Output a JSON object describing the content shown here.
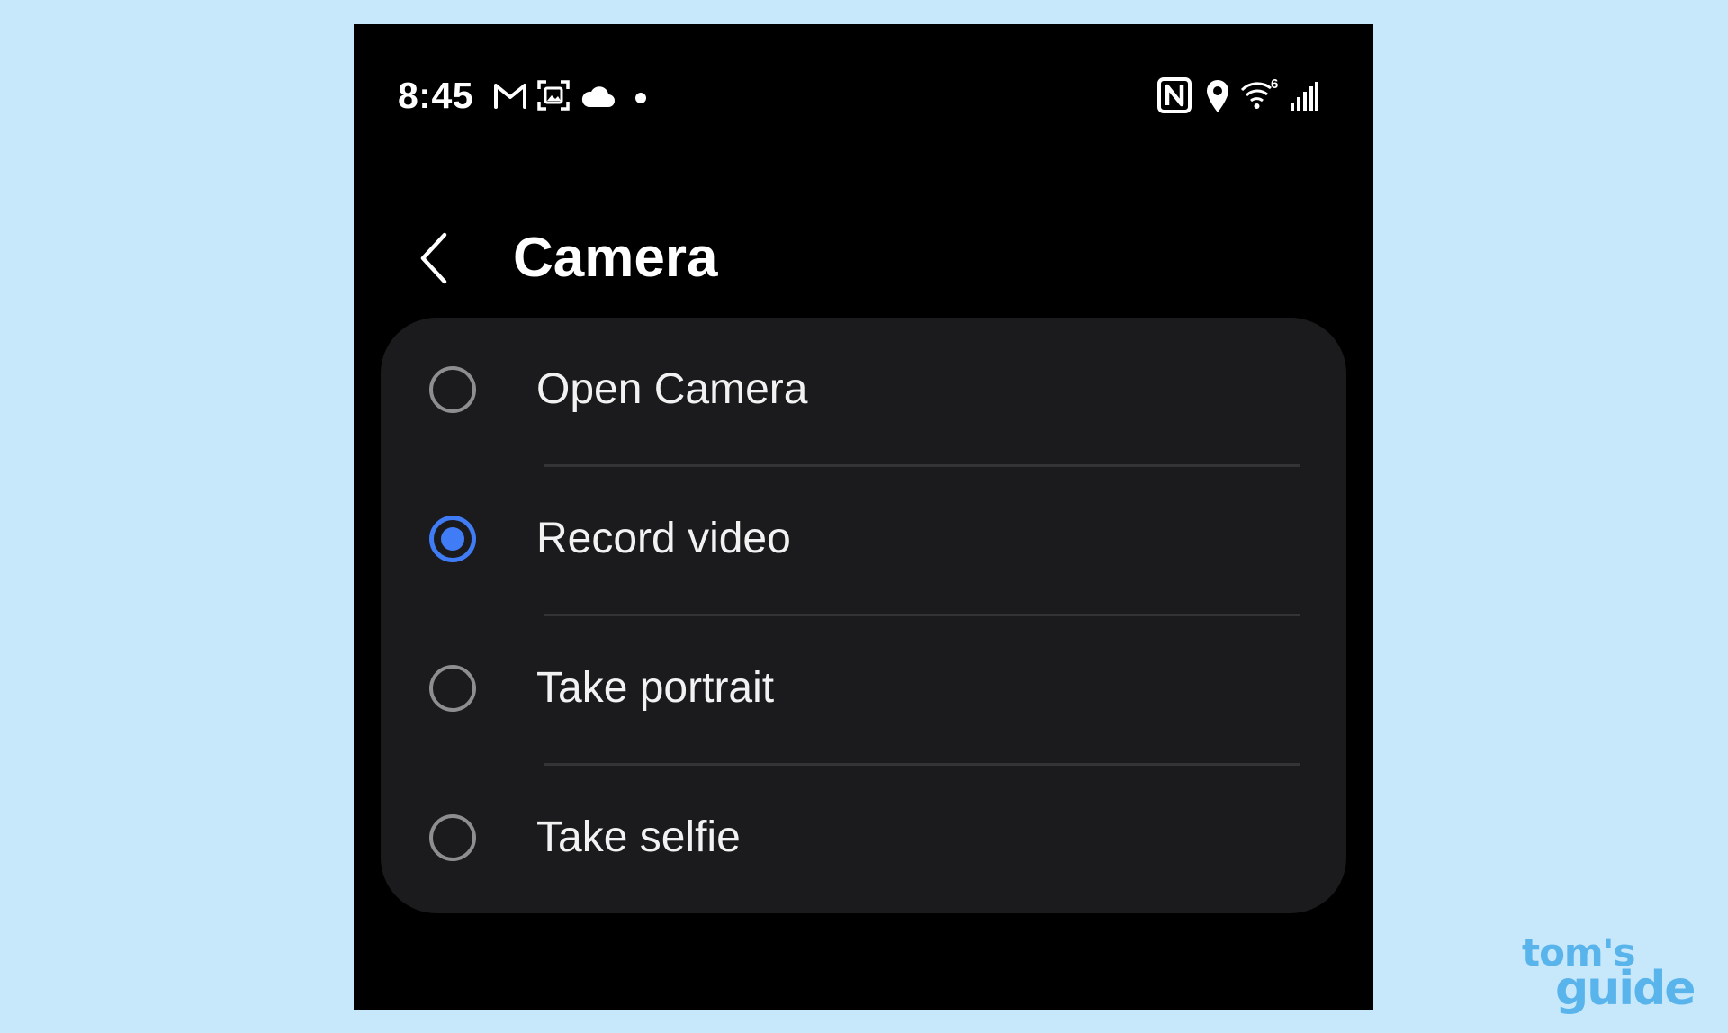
{
  "status_bar": {
    "time": "8:45",
    "left_icons": [
      "gmail-icon",
      "screenshot-icon",
      "cloud-icon",
      "notification-dot-icon"
    ],
    "right_icons": [
      "nfc-icon",
      "location-icon",
      "wifi-6-icon",
      "signal-icon"
    ],
    "wifi_badge": "6"
  },
  "header": {
    "back_icon": "chevron-left-icon",
    "title": "Camera"
  },
  "options": [
    {
      "label": "Open Camera",
      "selected": false
    },
    {
      "label": "Record video",
      "selected": true
    },
    {
      "label": "Take portrait",
      "selected": false
    },
    {
      "label": "Take selfie",
      "selected": false
    }
  ],
  "watermark": {
    "line1": "tom's",
    "line2": "guide"
  },
  "colors": {
    "accent": "#3f7cf6",
    "page_background": "#c7e8fb",
    "phone_background": "#000000",
    "card_background": "#1b1b1d",
    "watermark": "#5ab4ec"
  }
}
